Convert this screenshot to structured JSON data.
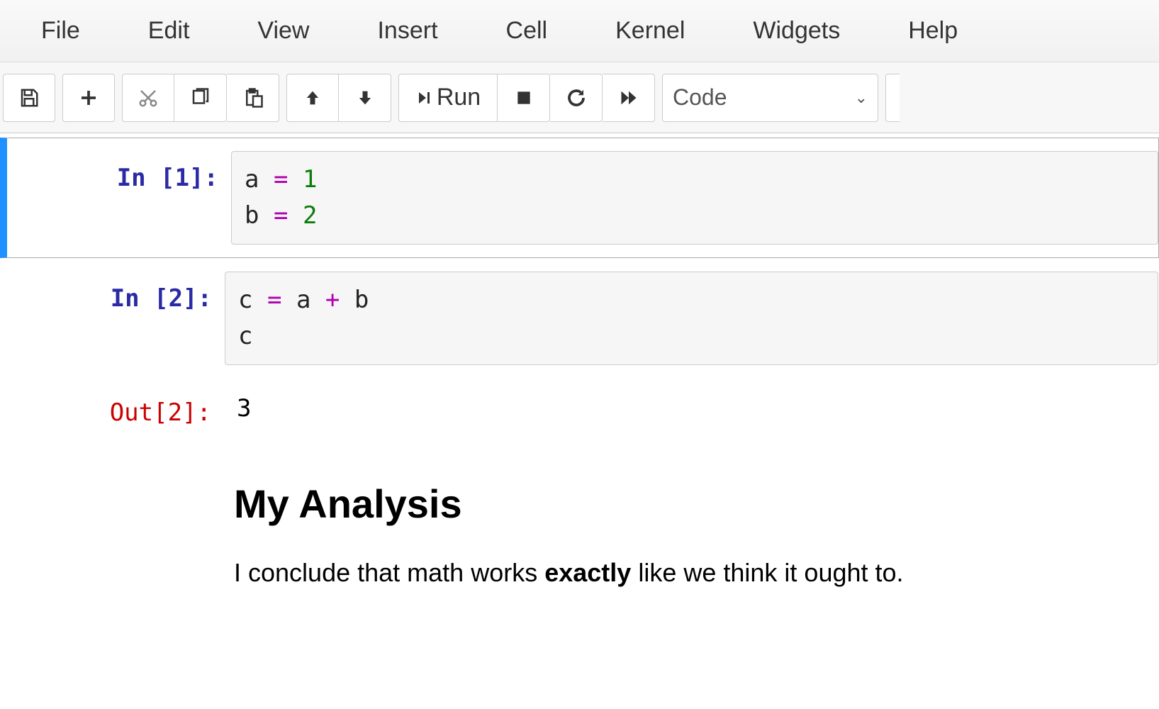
{
  "menubar": {
    "items": [
      "File",
      "Edit",
      "View",
      "Insert",
      "Cell",
      "Kernel",
      "Widgets",
      "Help"
    ]
  },
  "toolbar": {
    "run_label": "Run",
    "cell_type_selected": "Code"
  },
  "cells": [
    {
      "type": "code",
      "selected": true,
      "in_prompt": "In [1]:",
      "line1": {
        "var": "a",
        "op": "=",
        "num": "1"
      },
      "line2": {
        "var": "b",
        "op": "=",
        "num": "2"
      }
    },
    {
      "type": "code",
      "selected": false,
      "in_prompt": "In [2]:",
      "line1": {
        "var": "c",
        "op": "=",
        "rhs_a": "a",
        "rhs_op": "+",
        "rhs_b": "b"
      },
      "line2": {
        "var": "c"
      },
      "out_prompt": "Out[2]:",
      "output": "3"
    },
    {
      "type": "markdown",
      "heading": "My Analysis",
      "para_pre": "I conclude that math works ",
      "para_strong": "exactly",
      "para_post": " like we think it ought to."
    }
  ]
}
